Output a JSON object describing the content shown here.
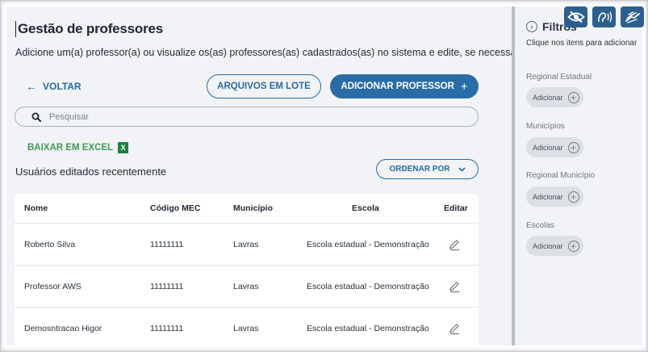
{
  "page": {
    "title": "Gestão de professores",
    "subtitle": "Adicione um(a) professor(a) ou visualize os(as) professores(as) cadastrados(as) no sistema e edite, se necessário."
  },
  "toolbar": {
    "back_label": "VOLTAR",
    "batch_label": "ARQUIVOS EM LOTE",
    "add_label": "ADICIONAR PROFESSOR"
  },
  "search": {
    "placeholder": "Pesquisar"
  },
  "excel": {
    "label": "BAIXAR EM EXCEL"
  },
  "section": {
    "title": "Usuários editados recentemente",
    "sort_label": "ORDENAR POR"
  },
  "table": {
    "headers": {
      "name": "Nome",
      "mec": "Código MEC",
      "municipio": "Município",
      "escola": "Escola",
      "editar": "Editar"
    },
    "rows": [
      {
        "name": "Roberto Silva",
        "mec": "11111111",
        "municipio": "Lavras",
        "escola": "Escola estadual - Demonstração"
      },
      {
        "name": "Professor AWS",
        "mec": "11111111",
        "municipio": "Lavras",
        "escola": "Escola estadual - Demonstração"
      },
      {
        "name": "Demosntracao Higor",
        "mec": "11111111",
        "municipio": "Lavras",
        "escola": "Escola estadual - Demonstração"
      }
    ]
  },
  "sidebar": {
    "title": "Filtros",
    "hint": "Clique nos itens para adicionar",
    "filters": [
      {
        "label": "Regional Estadual",
        "chip": "Adicionar"
      },
      {
        "label": "Municípios",
        "chip": "Adicionar"
      },
      {
        "label": "Regional Município",
        "chip": "Adicionar"
      },
      {
        "label": "Escolas",
        "chip": "Adicionar"
      }
    ]
  },
  "colors": {
    "primary": "#2a6da6",
    "excel_green": "#3f9a55",
    "a11y_blue": "#2d5f8e"
  },
  "icons": [
    "arrow-left-icon",
    "plus-icon",
    "search-icon",
    "excel-icon",
    "chevron-down-icon",
    "pencil-icon",
    "chevron-right-icon",
    "plus-circle-icon",
    "eye-slash-icon",
    "audio-icon",
    "sign-language-icon"
  ]
}
